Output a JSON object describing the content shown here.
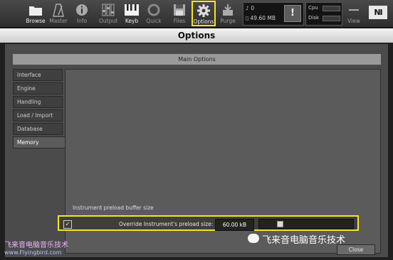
{
  "toolbar": {
    "buttons": [
      {
        "label": "Browse",
        "icon": "folder-icon",
        "active": true
      },
      {
        "label": "Master",
        "icon": "metronome-icon",
        "active": false
      },
      {
        "label": "Info",
        "icon": "info-icon",
        "active": false
      },
      {
        "label": "Output",
        "icon": "faders-icon",
        "active": false
      },
      {
        "label": "Keyb",
        "icon": "keyboard-icon",
        "active": true
      },
      {
        "label": "Quick",
        "icon": "quick-icon",
        "active": false
      },
      {
        "label": "Files",
        "icon": "floppy-icon",
        "active": false
      },
      {
        "label": "Options",
        "icon": "gear-icon",
        "active": true
      },
      {
        "label": "Purge",
        "icon": "purge-icon",
        "active": false
      },
      {
        "label": "View",
        "icon": "view-icon",
        "active": false
      }
    ],
    "meter_voices": "0",
    "meter_memory": "49.60 MB",
    "warning_symbol": "!",
    "cpu_label": "Cpu",
    "disk_label": "Disk",
    "logo": "NI"
  },
  "window": {
    "title": "Options",
    "main_header": "Main Options",
    "tabs": [
      "Interface",
      "Engine",
      "Handling",
      "Load / Import",
      "Database",
      "Memory"
    ],
    "active_tab": "Memory",
    "section_label": "Instrument preload buffer size",
    "option_label": "Override Instrument's preload size:",
    "option_value": "60.00 kB",
    "option_checked": true,
    "close_label": "Close"
  },
  "watermarks": {
    "left_line1": "飞来音电脑音乐技术",
    "left_line2": "www.Flyingbird.com",
    "right": "飞来音电脑音乐技术"
  },
  "colors": {
    "highlight": "#f4e61e",
    "panel": "#5b5b5b",
    "titlebar": "#e0e0e0"
  }
}
